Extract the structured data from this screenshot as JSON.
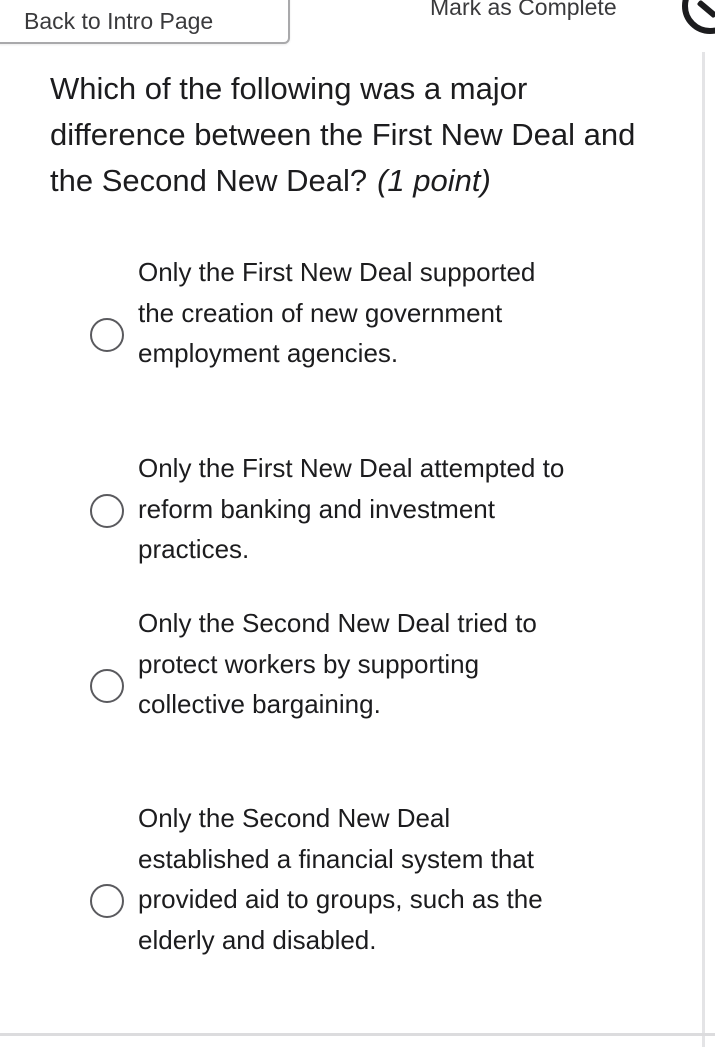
{
  "header": {
    "back_label": "Back to Intro Page",
    "mark_complete_label": "Mark as Complete"
  },
  "question": {
    "text": "Which of the following was a major difference between the First New Deal and the Second New Deal?",
    "points": "(1 point)"
  },
  "options": [
    {
      "label": "Only the First New Deal supported the creation of new government employment agencies.",
      "selected": false
    },
    {
      "label": "Only the First New Deal attempted to reform banking and investment practices.",
      "selected": false
    },
    {
      "label": "Only the Second New Deal tried to protect workers by supporting collective bargaining.",
      "selected": false
    },
    {
      "label": "Only the Second New Deal established a financial system that provided aid to groups, such as the elderly and disabled.",
      "selected": false
    }
  ],
  "colors": {
    "text": "#1c1c1e",
    "border": "#a9a9ab",
    "radio_border": "#5a5a5e",
    "background": "#ffffff"
  },
  "icons": {
    "complete": "check-circle-icon"
  }
}
